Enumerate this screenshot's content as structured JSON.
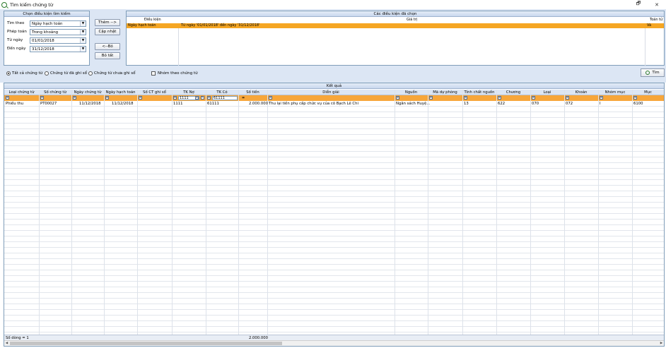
{
  "window": {
    "title": "Tìm kiếm chứng từ",
    "restore_glyph": "🗗",
    "close_glyph": "✕"
  },
  "search_panel": {
    "title": "Chọn điều kiện tìm kiếm",
    "fields": [
      {
        "label": "Tìm theo",
        "value": "Ngày hạch toán"
      },
      {
        "label": "Phép toán",
        "value": "Trong khoảng"
      },
      {
        "label": "Từ ngày",
        "value": "01/01/2018"
      },
      {
        "label": "Đến ngày",
        "value": "31/12/2018"
      }
    ]
  },
  "buttons": {
    "add": "Thêm -->",
    "update": "Cập nhật",
    "remove": "<--Bỏ",
    "remove_all": "Bỏ tất",
    "find": "Tìm"
  },
  "chosen_panel": {
    "title": "Các điều kiện đã chọn",
    "columns": [
      "Điều kiện",
      "Giá trị",
      "Toán tử"
    ],
    "row": {
      "condition": "Ngày hạch toán",
      "value": "Từ ngày '01/01/2018' đến ngày '31/12/2018'",
      "operator": "Và"
    }
  },
  "options": {
    "all": "Tất cả chứng từ",
    "posted": "Chứng từ đã ghi sổ",
    "unposted": "Chứng từ chưa ghi sổ",
    "group": "Nhóm theo chứng từ"
  },
  "results": {
    "title": "Kết quả",
    "columns": [
      "Loại chứng từ",
      "Số chứng từ",
      "Ngày chứng từ",
      "Ngày hạch toán",
      "Số CT ghi sổ",
      "TK Nợ",
      "TK Có",
      "Số tiền",
      "Diễn giải",
      "Nguồn",
      "Mã dự phòng",
      "Tính chất nguồn",
      "Chương",
      "Loại",
      "Khoản",
      "Nhóm mục",
      "Mục"
    ],
    "filters": {
      "tk_no": "1111",
      "tk_co": "61111",
      "so_tien": "="
    },
    "row": {
      "loai": "Phiếu thu",
      "so_ct": "PT00027",
      "ngay_ct": "11/12/2018",
      "ngay_ht": "11/12/2018",
      "tk_no": "1111",
      "tk_co": "61111",
      "so_tien": "2.000.000",
      "dien_giai": "Thu lại tiền phụ cấp chức vụ của cô Bạch Lê Chi",
      "nguon": "Ngân sách Huyệ...",
      "tinh_chat": "13",
      "chuong": "622",
      "loai_kt": "070",
      "khoan": "072",
      "nhom_muc": "I",
      "muc": "6100"
    },
    "footer": {
      "count": "Số dòng = 1",
      "total": "2.000.000"
    }
  }
}
